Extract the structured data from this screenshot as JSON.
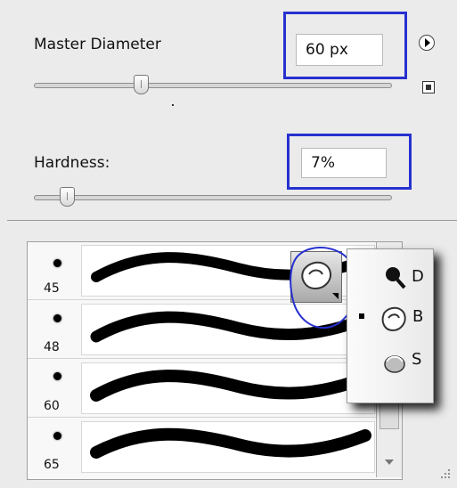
{
  "master_diameter": {
    "label": "Master Diameter",
    "value": "60 px",
    "slider_fraction": 0.26
  },
  "hardness": {
    "label": "Hardness:",
    "value": "7%",
    "slider_fraction": 0.07
  },
  "brushes": [
    {
      "size": "45"
    },
    {
      "size": "48"
    },
    {
      "size": "60"
    },
    {
      "size": "65"
    }
  ],
  "popup_menu": {
    "items": [
      {
        "label": "D",
        "icon": "magnifier-icon"
      },
      {
        "label": "B",
        "icon": "brush-tip-icon",
        "selected": true
      },
      {
        "label": "S",
        "icon": "stroke-icon"
      }
    ]
  },
  "colors": {
    "highlight": "#2731cf",
    "panel": "#ebebeb"
  }
}
